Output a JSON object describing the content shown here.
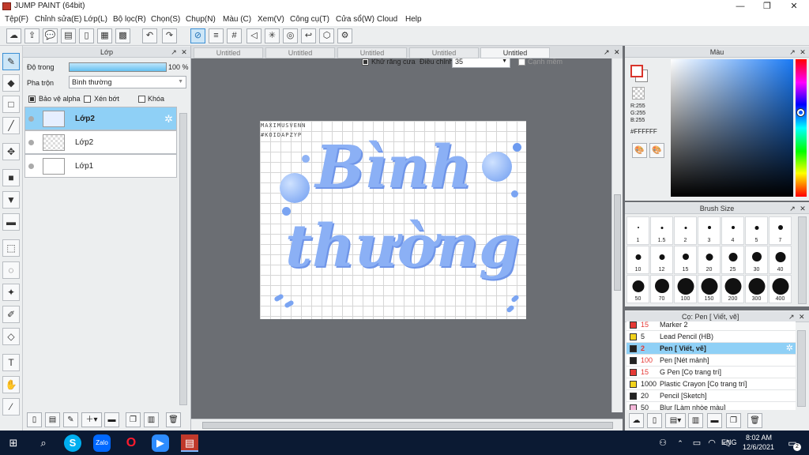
{
  "app": {
    "title": "JUMP PAINT (64bit)"
  },
  "menu": [
    "Tệp(F)",
    "Chỉnh sửa(E)",
    "Lớp(L)",
    "Bộ lọc(R)",
    "Chọn(S)",
    "Chụp(N)",
    "Màu (C)",
    "Xem(V)",
    "Công cụ(T)",
    "Cửa sổ(W)",
    "Cloud",
    "Help"
  ],
  "toolbar": {
    "antialias_label": "Khử răng cưa",
    "adjust_label": "Điều chỉnh",
    "adjust_value": "35",
    "edge_label": "Cạnh mềm"
  },
  "layer_panel": {
    "title": "Lớp",
    "opacity_label": "Độ trong",
    "opacity_value": "100 %",
    "opacity_percent": 100,
    "blend_label": "Pha trộn",
    "blend_value": "Bình thường",
    "protect_alpha": "Bảo vệ alpha",
    "clip": "Xén bớt",
    "lock": "Khóa",
    "layers": [
      {
        "name": "Lớp2",
        "selected": true
      },
      {
        "name": "Lớp2",
        "selected": false
      },
      {
        "name": "Lớp1",
        "selected": false
      }
    ]
  },
  "tabs": [
    "Untitled",
    "Untitled",
    "Untitled",
    "Untitled",
    "Untitled"
  ],
  "canvas_art": {
    "watermark_line1": "MAXIMUSVENN",
    "watermark_line2": "#KOIDAPZYP",
    "line1": "Bình",
    "line2": "thường"
  },
  "color_panel": {
    "title": "Màu",
    "r": "R:255",
    "g": "G:255",
    "b": "B:255",
    "hex": "#FFFFFF"
  },
  "brush_panel": {
    "title": "Brush Size",
    "sizes": [
      "1",
      "1.5",
      "2",
      "3",
      "4",
      "5",
      "7",
      "10",
      "12",
      "15",
      "20",
      "25",
      "30",
      "40",
      "50",
      "70",
      "100",
      "150",
      "200",
      "300",
      "400"
    ]
  },
  "pen_panel": {
    "title": "Cọ: Pen [ Viết, vẽ]",
    "items": [
      {
        "size": "15",
        "name": "Marker 2",
        "color": "#e53935"
      },
      {
        "size": "5",
        "name": "Lead Pencil (HB)",
        "color": "#f2d21b"
      },
      {
        "size": "2",
        "name": "Pen [ Viết, vẽ]",
        "color": "#222222",
        "selected": true
      },
      {
        "size": "100",
        "name": "Pen [Nét mảnh]",
        "color": "#222222"
      },
      {
        "size": "15",
        "name": "G Pen [Cọ trang trí]",
        "color": "#e53935"
      },
      {
        "size": "1000",
        "name": "Plastic Crayon [Cọ trang trí]",
        "color": "#f2d21b"
      },
      {
        "size": "20",
        "name": "Pencil [Sketch]",
        "color": "#222222"
      },
      {
        "size": "50",
        "name": "Blur [Làm nhòe màu]",
        "color": "#f4b6d8"
      }
    ]
  },
  "taskbar": {
    "time": "8:02 AM",
    "date": "12/6/2021",
    "lang": "ENG",
    "notif": "2"
  }
}
